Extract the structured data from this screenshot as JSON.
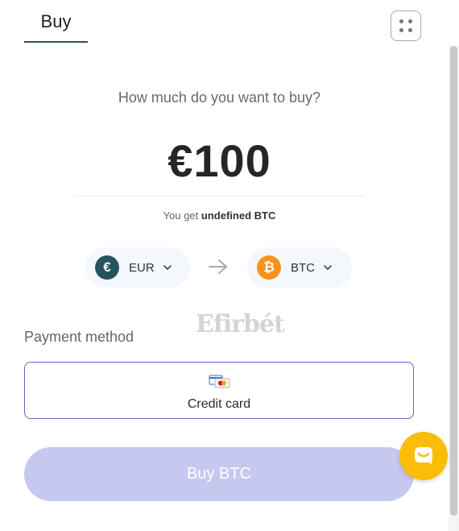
{
  "tabs": {
    "buy_label": "Buy"
  },
  "header": {
    "menu_icon": "grid-dots-icon"
  },
  "purchase": {
    "question": "How much do you want to buy?",
    "amount": "€100",
    "you_get_prefix": "You get",
    "you_get_value": "undefined BTC"
  },
  "currencies": {
    "from": {
      "label": "EUR",
      "icon": "euro-coin-icon",
      "symbol": "€",
      "color": "#25545f"
    },
    "to": {
      "label": "BTC",
      "icon": "bitcoin-coin-icon",
      "symbol": "₿",
      "color": "#f7931a"
    },
    "arrow_icon": "arrow-right-icon"
  },
  "watermark": "Efirbét",
  "payment": {
    "section_label": "Payment method",
    "selected": {
      "name": "Credit card",
      "icon": "credit-card-icon"
    }
  },
  "actions": {
    "buy_label": "Buy BTC",
    "buy_color": "#c6c8f0"
  },
  "chat": {
    "icon": "chat-bubble-icon",
    "color": "#fbbd07"
  },
  "colors": {
    "accent": "#25545f",
    "selection_border": "#6b62c9"
  }
}
